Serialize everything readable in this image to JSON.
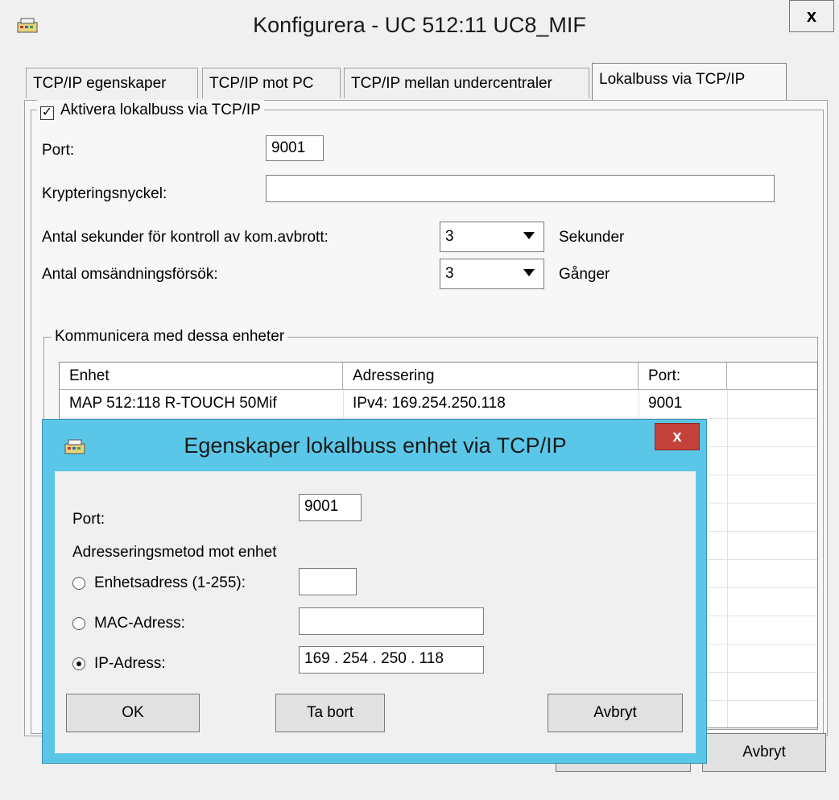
{
  "window": {
    "title": "Konfigurera - UC 512:11 UC8_MIF",
    "close_label": "x"
  },
  "tabs": [
    {
      "label": "TCP/IP egenskaper"
    },
    {
      "label": "TCP/IP mot PC"
    },
    {
      "label": "TCP/IP mellan undercentraler"
    },
    {
      "label": "Lokalbuss via TCP/IP",
      "active": true
    }
  ],
  "panel": {
    "enable_label": "Aktivera lokalbuss via TCP/IP",
    "enable_checked": true,
    "port_label": "Port:",
    "port_value": "9001",
    "key_label": "Krypteringsnyckel:",
    "key_value": "",
    "timeout_label": "Antal sekunder för kontroll av kom.avbrott:",
    "timeout_value": "3",
    "timeout_unit": "Sekunder",
    "retries_label": "Antal omsändningsförsök:",
    "retries_value": "3",
    "retries_unit": "Gånger",
    "devices_group_label": "Kommunicera med dessa enheter",
    "columns": [
      "Enhet",
      "Adressering",
      "Port:"
    ],
    "rows": [
      [
        "MAP 512:118 R-TOUCH 50Mif",
        "IPv4: 169.254.250.118",
        "9001"
      ]
    ]
  },
  "footer": {
    "cancel_label": "Avbryt"
  },
  "dialog": {
    "title": "Egenskaper lokalbuss enhet via TCP/IP",
    "close_label": "x",
    "port_label": "Port:",
    "port_value": "9001",
    "method_label": "Adresseringsmetod mot enhet",
    "options": [
      {
        "label": "Enhetsadress (1-255):",
        "value": "",
        "selected": false
      },
      {
        "label": "MAC-Adress:",
        "value": "",
        "selected": false
      },
      {
        "label": "IP-Adress:",
        "value": "169 . 254 . 250 . 118",
        "selected": true
      }
    ],
    "ok_label": "OK",
    "remove_label": "Ta bort",
    "cancel_label": "Avbryt"
  }
}
